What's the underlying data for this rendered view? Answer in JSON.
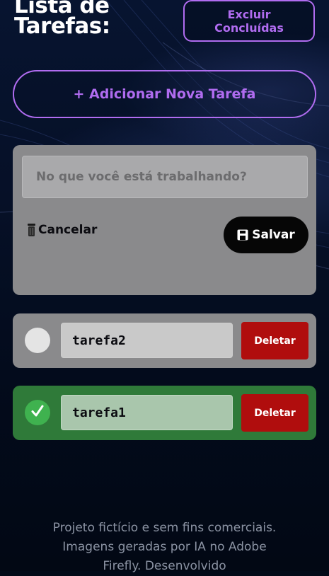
{
  "header": {
    "title": "Lista de Tarefas:",
    "clear_completed_label": "Excluir Concluídas"
  },
  "add_task_label": "+ Adicionar Nova Tarefa",
  "form": {
    "input_placeholder": "No que você está trabalhando?",
    "cancel_label": "Cancelar",
    "save_label": "Salvar"
  },
  "tasks": [
    {
      "name": "tarefa2",
      "done": false,
      "delete_label": "Deletar"
    },
    {
      "name": "tarefa1",
      "done": true,
      "delete_label": "Deletar"
    }
  ],
  "footer_text": "Projeto fictício e sem fins comerciais. Imagens geradas por IA no Adobe Firefly. Desenvolvido",
  "colors": {
    "accent": "#b06cf0",
    "panel": "#8a8a8c",
    "done_green": "#2f7a39",
    "delete_red": "#b00d0d",
    "background": "#020a18"
  },
  "icons": {
    "cancel": "trash-icon",
    "save": "floppy-disk-icon",
    "done": "checkmark-icon"
  }
}
